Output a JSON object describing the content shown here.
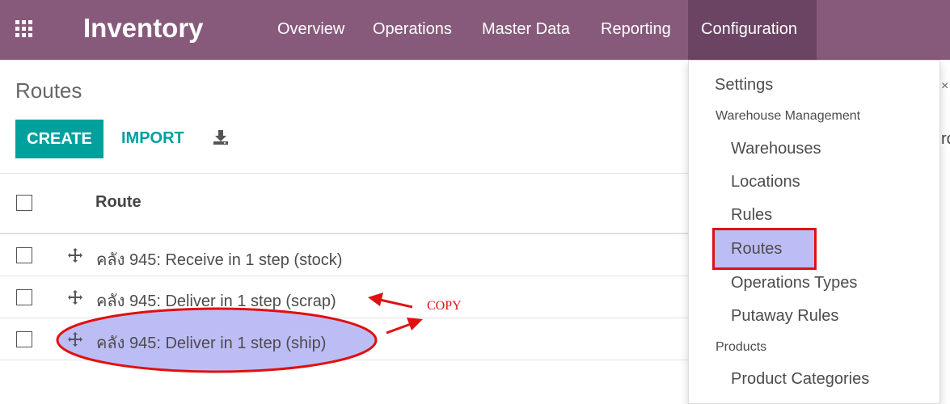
{
  "navbar": {
    "app_title": "Inventory",
    "menus": [
      "Overview",
      "Operations",
      "Master Data",
      "Reporting",
      "Configuration"
    ],
    "background": "#875a7b",
    "active_background": "#6b4464"
  },
  "control_panel": {
    "breadcrumb": "Routes",
    "create_label": "CREATE",
    "import_label": "IMPORT",
    "download_icon": "download-icon",
    "accent": "#00a09d"
  },
  "list": {
    "column_header": "Route",
    "rows": [
      "คลัง 945: Receive in 1 step (stock)",
      "คลัง 945: Deliver in 1 step (scrap)",
      "คลัง 945: Deliver in 1 step (ship)"
    ]
  },
  "dropdown": {
    "settings": "Settings",
    "section_warehouse": "Warehouse Management",
    "warehouses": "Warehouses",
    "locations": "Locations",
    "rules": "Rules",
    "routes": "Routes",
    "operations_types": "Operations Types",
    "putaway_rules": "Putaway Rules",
    "section_products": "Products",
    "product_categories": "Product Categories"
  },
  "annotation": {
    "copy_label": "COPY",
    "color": "#e01010",
    "highlight_fill": "#bdbdf6"
  },
  "edge": {
    "partial_x": "×",
    "partial_r": "ro"
  }
}
